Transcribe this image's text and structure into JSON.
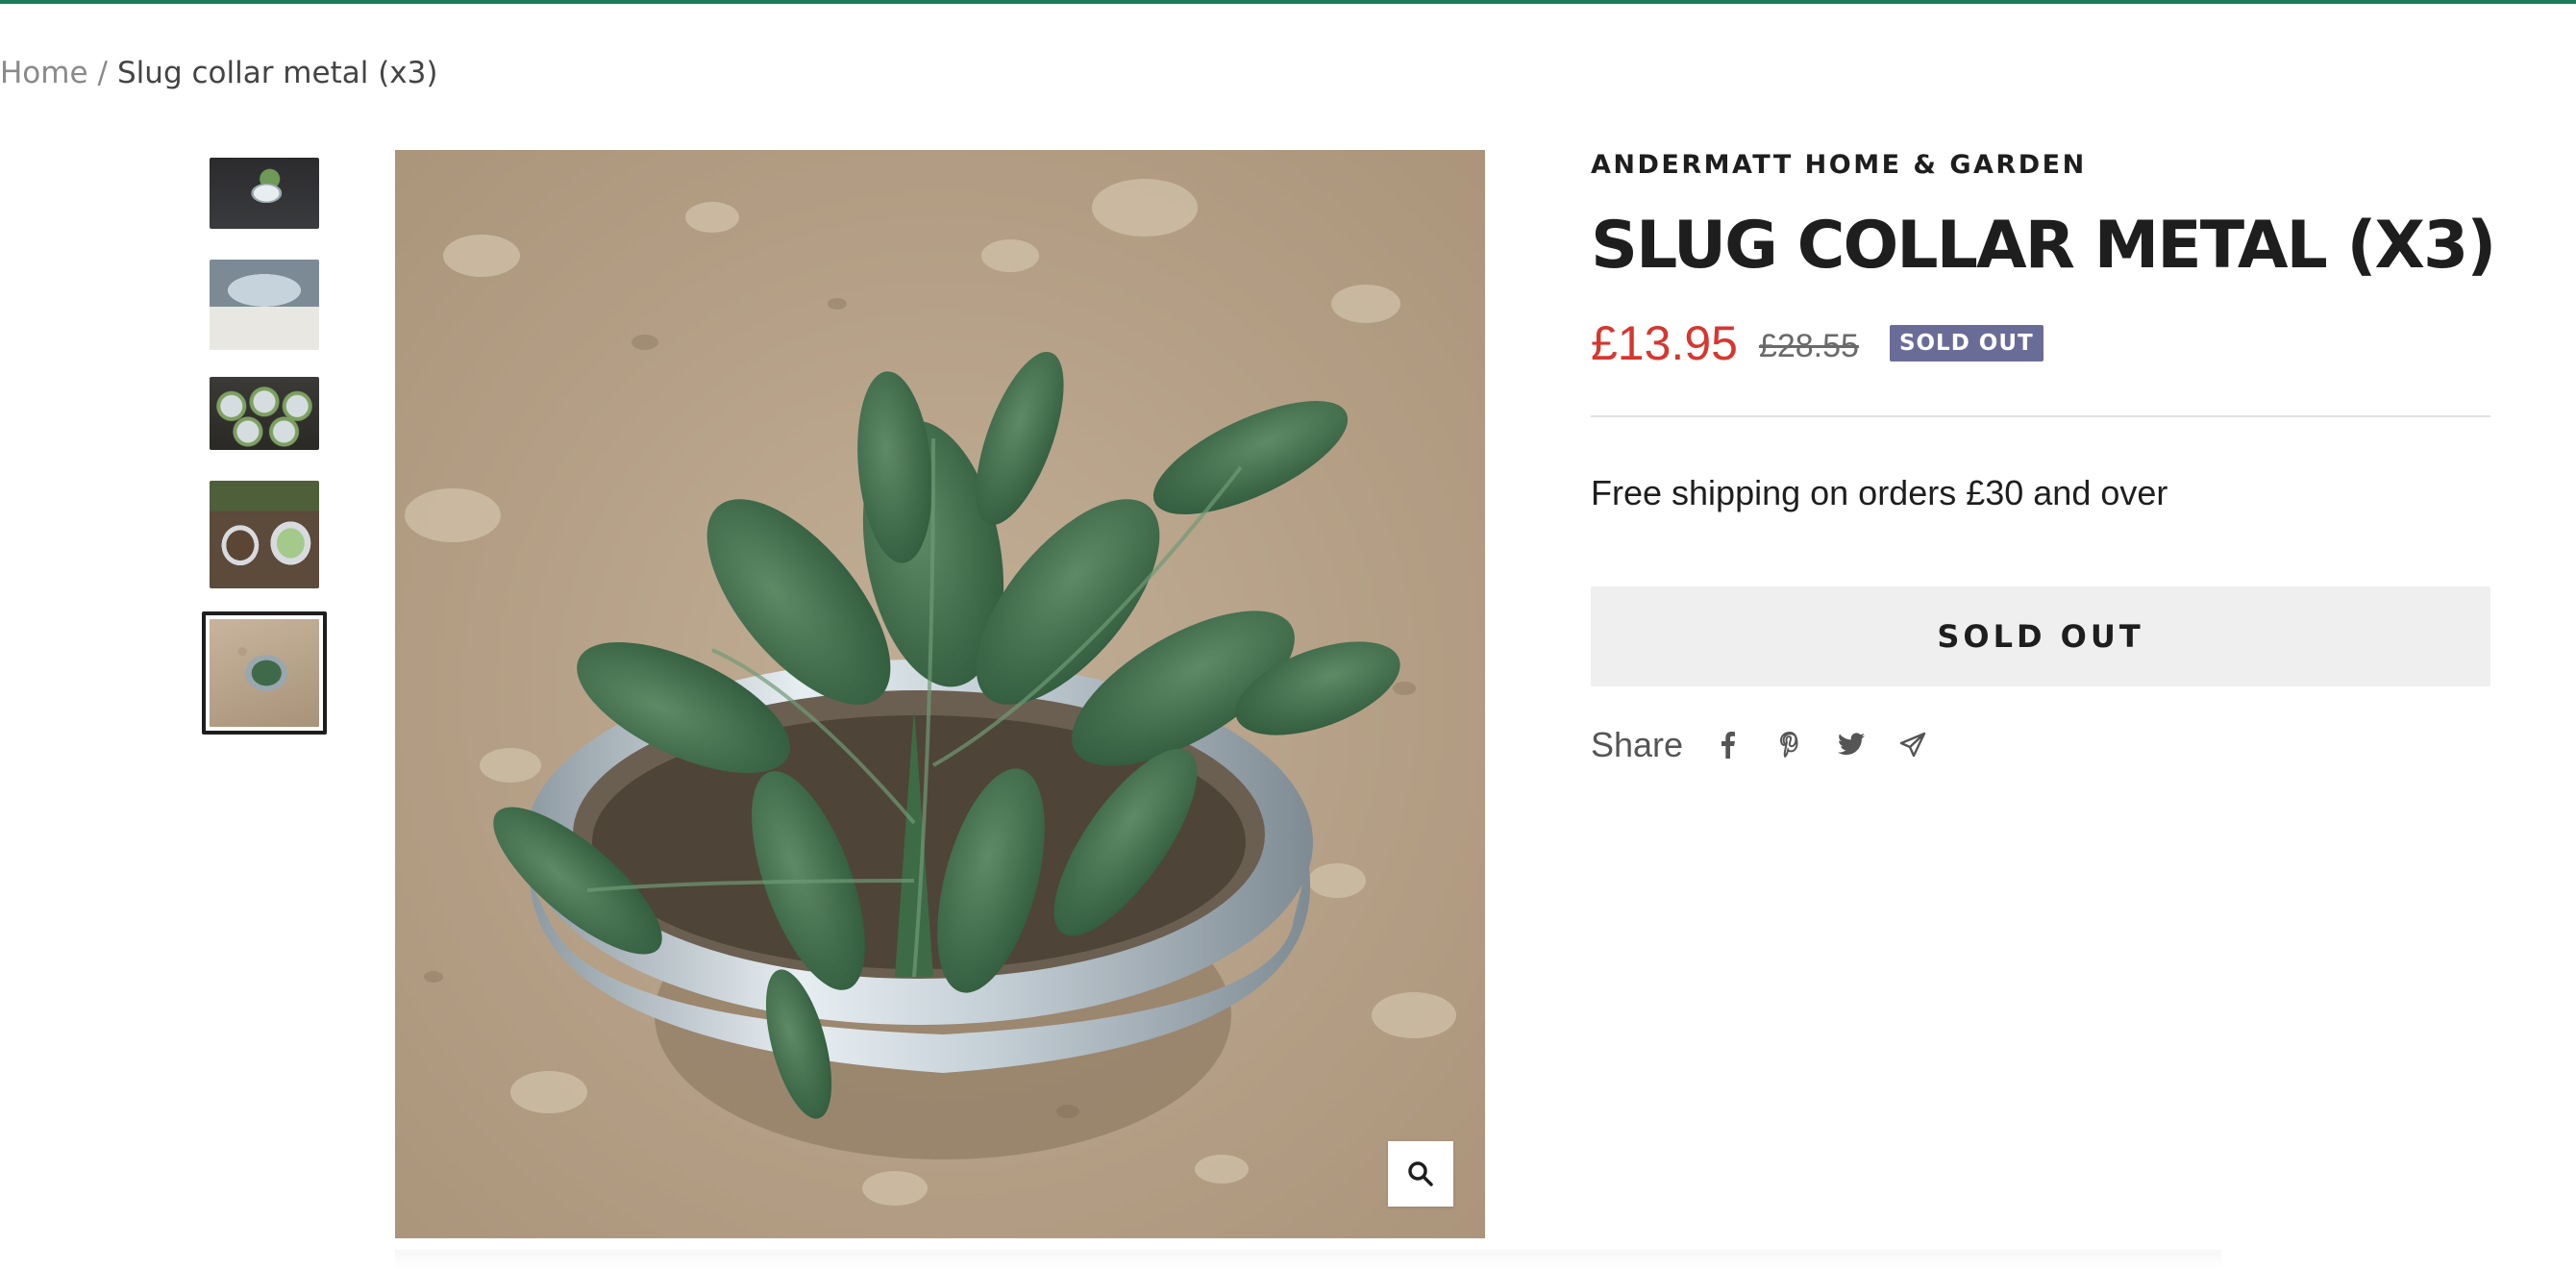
{
  "breadcrumb": {
    "home": "Home",
    "separator": "/",
    "current": "Slug collar metal (x3)"
  },
  "gallery": {
    "thumbnails": [
      {
        "icon": "product-thumbnail-1"
      },
      {
        "icon": "product-thumbnail-2"
      },
      {
        "icon": "product-thumbnail-3"
      },
      {
        "icon": "product-thumbnail-4"
      },
      {
        "icon": "product-thumbnail-5",
        "active": true
      }
    ],
    "zoom_icon": "search-icon"
  },
  "product": {
    "vendor": "ANDERMATT HOME & GARDEN",
    "title": "SLUG COLLAR METAL (X3)",
    "sale_price": "£13.95",
    "compare_price": "£28.55",
    "badge": "SOLD OUT",
    "shipping_note": "Free shipping on orders £30 and over",
    "button_label": "SOLD OUT"
  },
  "share": {
    "label": "Share",
    "icons": [
      "facebook-icon",
      "pinterest-icon",
      "twitter-icon",
      "email-icon"
    ]
  },
  "colors": {
    "accent": "#1f7a5c",
    "sale_price": "#d6372f",
    "badge_bg": "#6a6c98",
    "button_bg": "#efefef"
  }
}
